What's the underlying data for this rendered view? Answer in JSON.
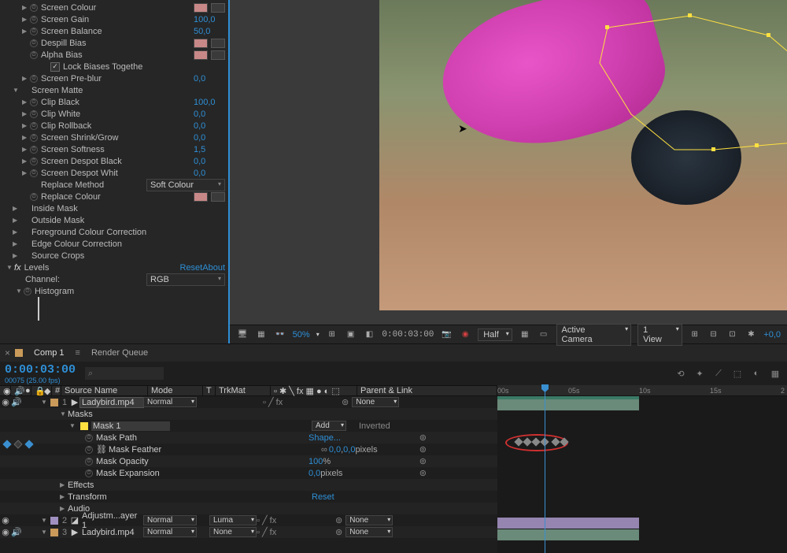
{
  "effects": {
    "rows": [
      {
        "indent": 2,
        "tw": "▶",
        "sw": true,
        "label": "Screen Colour",
        "swatch": true
      },
      {
        "indent": 2,
        "tw": "▶",
        "sw": true,
        "label": "Screen Gain",
        "value": "100,0"
      },
      {
        "indent": 2,
        "tw": "▶",
        "sw": true,
        "label": "Screen Balance",
        "value": "50,0"
      },
      {
        "indent": 2,
        "tw": "",
        "sw": true,
        "label": "Despill Bias",
        "swatch": true
      },
      {
        "indent": 2,
        "tw": "",
        "sw": true,
        "label": "Alpha Bias",
        "swatch": true
      },
      {
        "indent": 3,
        "tw": "",
        "sw": false,
        "label": "",
        "check": true,
        "checkLabel": "Lock Biases Togethe"
      },
      {
        "indent": 2,
        "tw": "▶",
        "sw": true,
        "label": "Screen Pre-blur",
        "value": "0,0"
      },
      {
        "indent": 1,
        "tw": "▼",
        "sw": false,
        "label": "Screen Matte"
      },
      {
        "indent": 2,
        "tw": "▶",
        "sw": true,
        "label": "Clip Black",
        "value": "100,0"
      },
      {
        "indent": 2,
        "tw": "▶",
        "sw": true,
        "label": "Clip White",
        "value": "0,0"
      },
      {
        "indent": 2,
        "tw": "▶",
        "sw": true,
        "label": "Clip Rollback",
        "value": "0,0"
      },
      {
        "indent": 2,
        "tw": "▶",
        "sw": true,
        "label": "Screen Shrink/Grow",
        "value": "0,0"
      },
      {
        "indent": 2,
        "tw": "▶",
        "sw": true,
        "label": "Screen Softness",
        "value": "1,5"
      },
      {
        "indent": 2,
        "tw": "▶",
        "sw": true,
        "label": "Screen Despot Black",
        "value": "0,0"
      },
      {
        "indent": 2,
        "tw": "▶",
        "sw": true,
        "label": "Screen Despot Whit",
        "value": "0,0"
      },
      {
        "indent": 2,
        "tw": "",
        "sw": false,
        "label": "Replace Method",
        "select": "Soft Colour"
      },
      {
        "indent": 2,
        "tw": "",
        "sw": true,
        "label": "Replace Colour",
        "swatch": true
      },
      {
        "indent": 1,
        "tw": "▶",
        "sw": false,
        "label": "Inside Mask"
      },
      {
        "indent": 1,
        "tw": "▶",
        "sw": false,
        "label": "Outside Mask"
      },
      {
        "indent": 1,
        "tw": "▶",
        "sw": false,
        "label": "Foreground Colour Correction"
      },
      {
        "indent": 1,
        "tw": "▶",
        "sw": false,
        "label": "Edge Colour Correction"
      },
      {
        "indent": 1,
        "tw": "▶",
        "sw": false,
        "label": "Source Crops"
      }
    ],
    "levels": {
      "fx": "fx",
      "name": "Levels",
      "reset": "Reset",
      "about": "About"
    },
    "channel": {
      "label": "Channel:",
      "value": "RGB"
    },
    "histogram": "Histogram"
  },
  "viewer": {
    "zoom": "50%",
    "time": "0:00:03:00",
    "quality": "Half",
    "camera": "Active Camera",
    "views": "1 View",
    "offset": "+0,0"
  },
  "timeline": {
    "tabs": {
      "close": "×",
      "comp": "Comp 1",
      "menu": "≡",
      "render": "Render Queue"
    },
    "timecode": "0:00:03:00",
    "subcode": "00075 (25.00 fps)",
    "searchPlaceholder": "⌕",
    "cols": {
      "source": "Source Name",
      "mode": "Mode",
      "t": "T",
      "trkmat": "TrkMat",
      "parent": "Parent & Link"
    },
    "ruler": [
      "00s",
      "05s",
      "10s",
      "15s",
      "2"
    ],
    "layers": [
      {
        "num": "1",
        "color": "#c99a5a",
        "icon": "▶",
        "name": "Ladybird.mp4",
        "boxed": true,
        "mode": "Normal",
        "parent": "None",
        "eye": true,
        "spk": true
      },
      {
        "masks": "Masks"
      },
      {
        "mask1": "Mask 1",
        "maskMode": "Add",
        "inverted": "Inverted"
      },
      {
        "prop": "Mask Path",
        "val": "Shape...",
        "sw": true
      },
      {
        "prop": "Mask Feather",
        "val": "0,0",
        "val2": "0,0",
        "unit": "pixels",
        "link": true
      },
      {
        "prop": "Mask Opacity",
        "val": "100",
        "unit": "%"
      },
      {
        "prop": "Mask Expansion",
        "val": "0,0",
        "unit": "pixels"
      },
      {
        "section": "Effects"
      },
      {
        "section": "Transform",
        "reset": "Reset"
      },
      {
        "section": "Audio"
      },
      {
        "num": "2",
        "color": "#a090c0",
        "name": "Adjustm...ayer 1",
        "mode": "Normal",
        "trk": "Luma",
        "parent": "None",
        "eye": true
      },
      {
        "num": "3",
        "color": "#c99a5a",
        "icon": "▶",
        "name": "Ladybird.mp4",
        "mode": "Normal",
        "trk": "None",
        "parent": "None",
        "eye": true,
        "spk": true
      }
    ]
  }
}
